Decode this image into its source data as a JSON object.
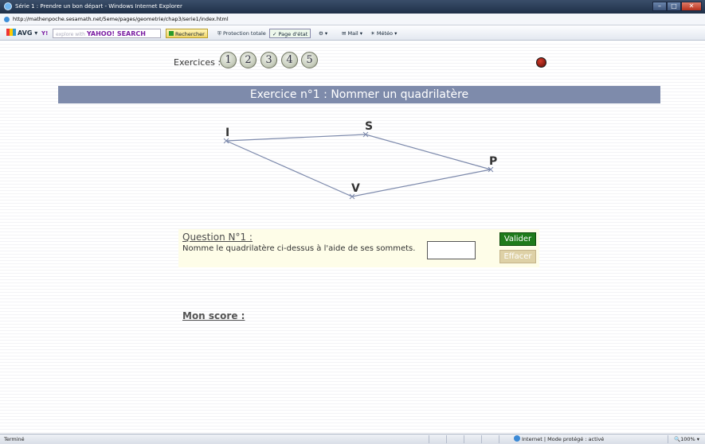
{
  "browser": {
    "window_title": "Série 1 : Prendre un bon départ - Windows Internet Explorer",
    "url": "http://mathenpoche.sesamath.net/5eme/pages/geometrie/chap3/serie1/index.html",
    "toolbar": {
      "avg": "AVG",
      "search_prefix": "explore with",
      "search_brand": "YAHOO! SEARCH",
      "rechercher": "Rechercher",
      "protection": "Protection totale",
      "page_etat": "Page d'état",
      "mail": "Mail",
      "meteo": "Météo"
    },
    "status_left": "Terminé",
    "status_zone": "Internet | Mode protégé : activé",
    "zoom": "100%"
  },
  "page": {
    "exercices_label": "Exercices :",
    "exercise_buttons": [
      "1",
      "2",
      "3",
      "4",
      "5"
    ],
    "banner_title": "Exercice n°1 : Nommer un quadrilatère",
    "figure": {
      "vertices": [
        "I",
        "S",
        "P",
        "V"
      ]
    },
    "question": {
      "title": "Question N°1 :",
      "text": "Nomme le quadrilatère ci-dessus à l'aide de ses sommets.",
      "answer_value": "",
      "valider": "Valider",
      "effacer": "Effacer"
    },
    "score_label": "Mon score :"
  }
}
